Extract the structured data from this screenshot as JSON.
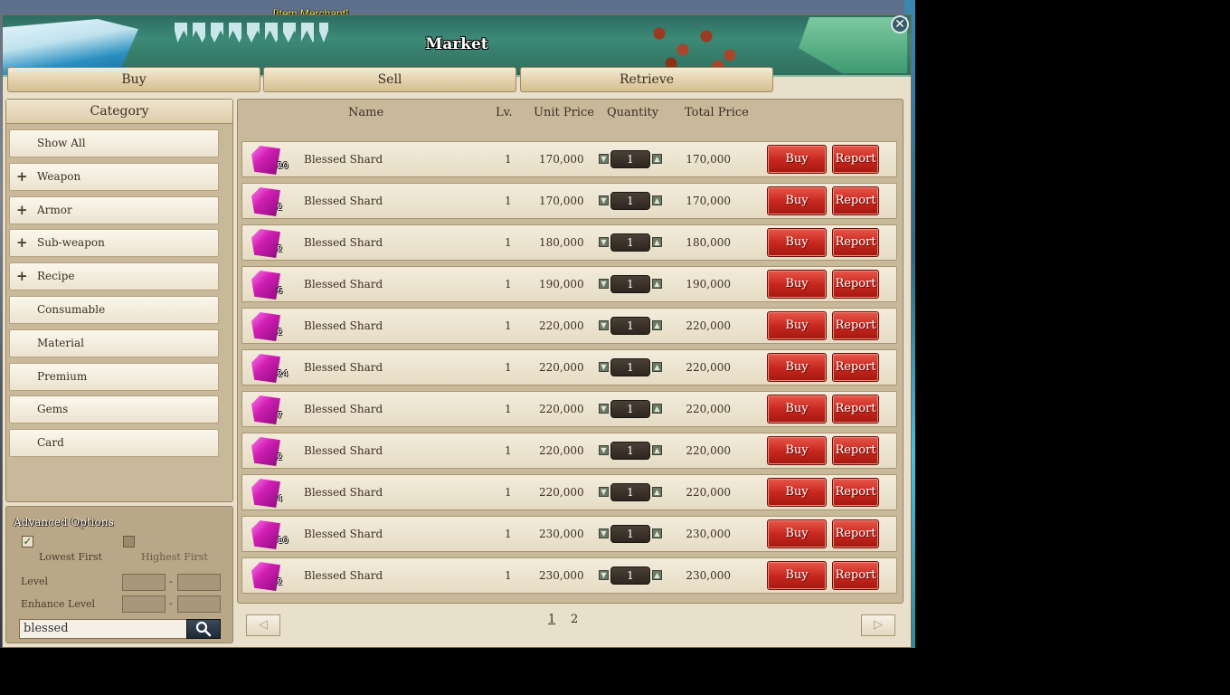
{
  "background": {
    "npc_label": "[Item Merchant]"
  },
  "window": {
    "title": "Market"
  },
  "tabs": [
    {
      "label": "Buy"
    },
    {
      "label": "Sell"
    },
    {
      "label": "Retrieve"
    }
  ],
  "category": {
    "header": "Category",
    "items": [
      {
        "label": "Show All",
        "expandable": false
      },
      {
        "label": "Weapon",
        "expandable": true
      },
      {
        "label": "Armor",
        "expandable": true
      },
      {
        "label": "Sub-weapon",
        "expandable": true
      },
      {
        "label": "Recipe",
        "expandable": true
      },
      {
        "label": "Consumable",
        "expandable": false
      },
      {
        "label": "Material",
        "expandable": false
      },
      {
        "label": "Premium",
        "expandable": false
      },
      {
        "label": "Gems",
        "expandable": false
      },
      {
        "label": "Card",
        "expandable": false
      }
    ],
    "plus": "+"
  },
  "advanced": {
    "title": "Advanced Options",
    "lowest_first": "Lowest First",
    "lowest_first_checked": true,
    "highest_first": "Highest First",
    "highest_first_checked": false,
    "level": "Level",
    "enhance_level": "Enhance Level",
    "range_sep": "-",
    "search_value": "blessed"
  },
  "columns": {
    "name": "Name",
    "level": "Lv.",
    "unit_price": "Unit Price",
    "quantity": "Quantity",
    "total_price": "Total Price"
  },
  "listings": [
    {
      "count": "20",
      "name": "Blessed Shard",
      "level": "1",
      "unit_price": "170,000",
      "quantity": "1",
      "total_price": "170,000"
    },
    {
      "count": "2",
      "name": "Blessed Shard",
      "level": "1",
      "unit_price": "170,000",
      "quantity": "1",
      "total_price": "170,000"
    },
    {
      "count": "2",
      "name": "Blessed Shard",
      "level": "1",
      "unit_price": "180,000",
      "quantity": "1",
      "total_price": "180,000"
    },
    {
      "count": "6",
      "name": "Blessed Shard",
      "level": "1",
      "unit_price": "190,000",
      "quantity": "1",
      "total_price": "190,000"
    },
    {
      "count": "2",
      "name": "Blessed Shard",
      "level": "1",
      "unit_price": "220,000",
      "quantity": "1",
      "total_price": "220,000"
    },
    {
      "count": "24",
      "name": "Blessed Shard",
      "level": "1",
      "unit_price": "220,000",
      "quantity": "1",
      "total_price": "220,000"
    },
    {
      "count": "7",
      "name": "Blessed Shard",
      "level": "1",
      "unit_price": "220,000",
      "quantity": "1",
      "total_price": "220,000"
    },
    {
      "count": "2",
      "name": "Blessed Shard",
      "level": "1",
      "unit_price": "220,000",
      "quantity": "1",
      "total_price": "220,000"
    },
    {
      "count": "4",
      "name": "Blessed Shard",
      "level": "1",
      "unit_price": "220,000",
      "quantity": "1",
      "total_price": "220,000"
    },
    {
      "count": "10",
      "name": "Blessed Shard",
      "level": "1",
      "unit_price": "230,000",
      "quantity": "1",
      "total_price": "230,000"
    },
    {
      "count": "2",
      "name": "Blessed Shard",
      "level": "1",
      "unit_price": "230,000",
      "quantity": "1",
      "total_price": "230,000"
    }
  ],
  "row_buttons": {
    "buy": "Buy",
    "report": "Report"
  },
  "pagination": {
    "pages": [
      "1",
      "2"
    ],
    "current": "1",
    "prev": "◁",
    "next": "▷"
  },
  "colors": {
    "accent_red": "#c8281f",
    "panel_tan": "#c8b99a",
    "gem_magenta": "#d01fb4"
  }
}
